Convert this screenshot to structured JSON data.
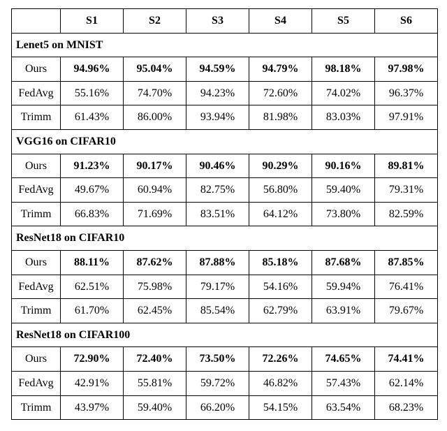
{
  "chart_data": {
    "type": "table",
    "column_headers": [
      "",
      "S1",
      "S2",
      "S3",
      "S4",
      "S5",
      "S6"
    ],
    "row_groups": [
      {
        "title": "Lenet5 on MNIST",
        "rows": [
          {
            "method": "Ours",
            "values": [
              "94.96%",
              "95.04%",
              "94.59%",
              "94.79%",
              "98.18%",
              "97.98%"
            ],
            "bold": true
          },
          {
            "method": "FedAvg",
            "values": [
              "55.16%",
              "74.70%",
              "94.23%",
              "72.60%",
              "74.02%",
              "96.37%"
            ],
            "bold": false
          },
          {
            "method": "Trimm",
            "values": [
              "61.43%",
              "86.00%",
              "93.94%",
              "81.98%",
              "83.03%",
              "97.91%"
            ],
            "bold": false
          }
        ]
      },
      {
        "title": "VGG16 on CIFAR10",
        "rows": [
          {
            "method": "Ours",
            "values": [
              "91.23%",
              "90.17%",
              "90.46%",
              "90.29%",
              "90.16%",
              "89.81%"
            ],
            "bold": true
          },
          {
            "method": "FedAvg",
            "values": [
              "49.67%",
              "60.94%",
              "82.75%",
              "56.80%",
              "59.40%",
              "79.31%"
            ],
            "bold": false
          },
          {
            "method": "Trimm",
            "values": [
              "66.83%",
              "71.69%",
              "83.51%",
              "64.12%",
              "73.80%",
              "82.59%"
            ],
            "bold": false
          }
        ]
      },
      {
        "title": "ResNet18 on CIFAR10",
        "rows": [
          {
            "method": "Ours",
            "values": [
              "88.11%",
              "87.62%",
              "87.88%",
              "85.18%",
              "87.68%",
              "87.85%"
            ],
            "bold": true
          },
          {
            "method": "FedAvg",
            "values": [
              "62.51%",
              "75.98%",
              "79.17%",
              "54.16%",
              "59.94%",
              "76.41%"
            ],
            "bold": false
          },
          {
            "method": "Trimm",
            "values": [
              "61.70%",
              "62.45%",
              "85.54%",
              "62.79%",
              "63.91%",
              "79.67%"
            ],
            "bold": false
          }
        ]
      },
      {
        "title": "ResNet18 on CIFAR100",
        "rows": [
          {
            "method": "Ours",
            "values": [
              "72.90%",
              "72.40%",
              "73.50%",
              "72.26%",
              "74.65%",
              "74.41%"
            ],
            "bold": true
          },
          {
            "method": "FedAvg",
            "values": [
              "42.91%",
              "55.81%",
              "59.72%",
              "46.82%",
              "57.43%",
              "62.14%"
            ],
            "bold": false
          },
          {
            "method": "Trimm",
            "values": [
              "43.97%",
              "59.40%",
              "66.20%",
              "54.15%",
              "63.54%",
              "68.23%"
            ],
            "bold": false
          }
        ]
      }
    ]
  }
}
